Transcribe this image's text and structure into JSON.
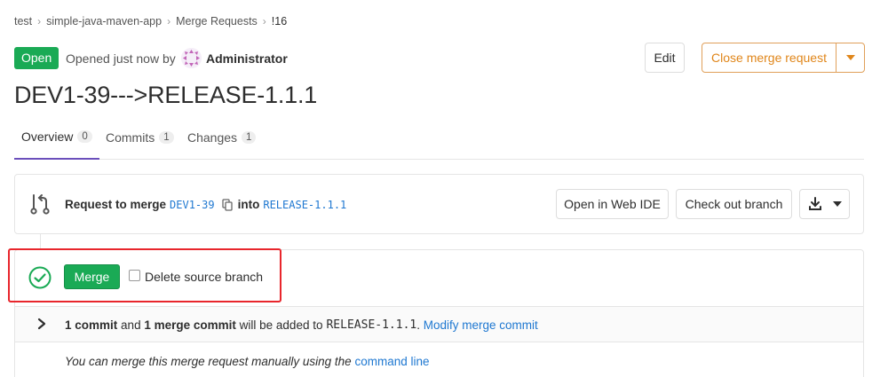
{
  "breadcrumb": {
    "items": [
      "test",
      "simple-java-maven-app",
      "Merge Requests",
      "!16"
    ],
    "separator": "›"
  },
  "header": {
    "status": "Open",
    "opened_text": "Opened just now by",
    "author": "Administrator",
    "edit_label": "Edit",
    "close_label": "Close merge request",
    "title": "DEV1-39--->RELEASE-1.1.1"
  },
  "tabs": [
    {
      "label": "Overview",
      "count": "0"
    },
    {
      "label": "Commits",
      "count": "1"
    },
    {
      "label": "Changes",
      "count": "1"
    }
  ],
  "merge_request": {
    "prefix": "Request to merge",
    "source_branch": "DEV1-39",
    "into": "into",
    "target_branch": "RELEASE-1.1.1",
    "web_ide_label": "Open in Web IDE",
    "checkout_label": "Check out branch"
  },
  "widget": {
    "merge_label": "Merge",
    "delete_source_label": "Delete source branch",
    "commit_count": "1 commit",
    "and": "and",
    "merge_commit_count": "1 merge commit",
    "added_text": "will be added to",
    "target_branch": "RELEASE-1.1.1",
    "period": ".",
    "modify_link": "Modify merge commit",
    "manual_text": "You can merge this merge request manually using the",
    "command_line_link": "command line"
  },
  "colors": {
    "success": "#1aaa55",
    "link": "#1f78d1",
    "warning": "#e0861a",
    "highlight": "#e8262c",
    "active_tab": "#6b4fbb"
  },
  "icons": [
    "merge-request-icon",
    "copy-icon",
    "download-icon",
    "chevron-down-icon",
    "check-circle-icon",
    "chevron-right-icon"
  ]
}
